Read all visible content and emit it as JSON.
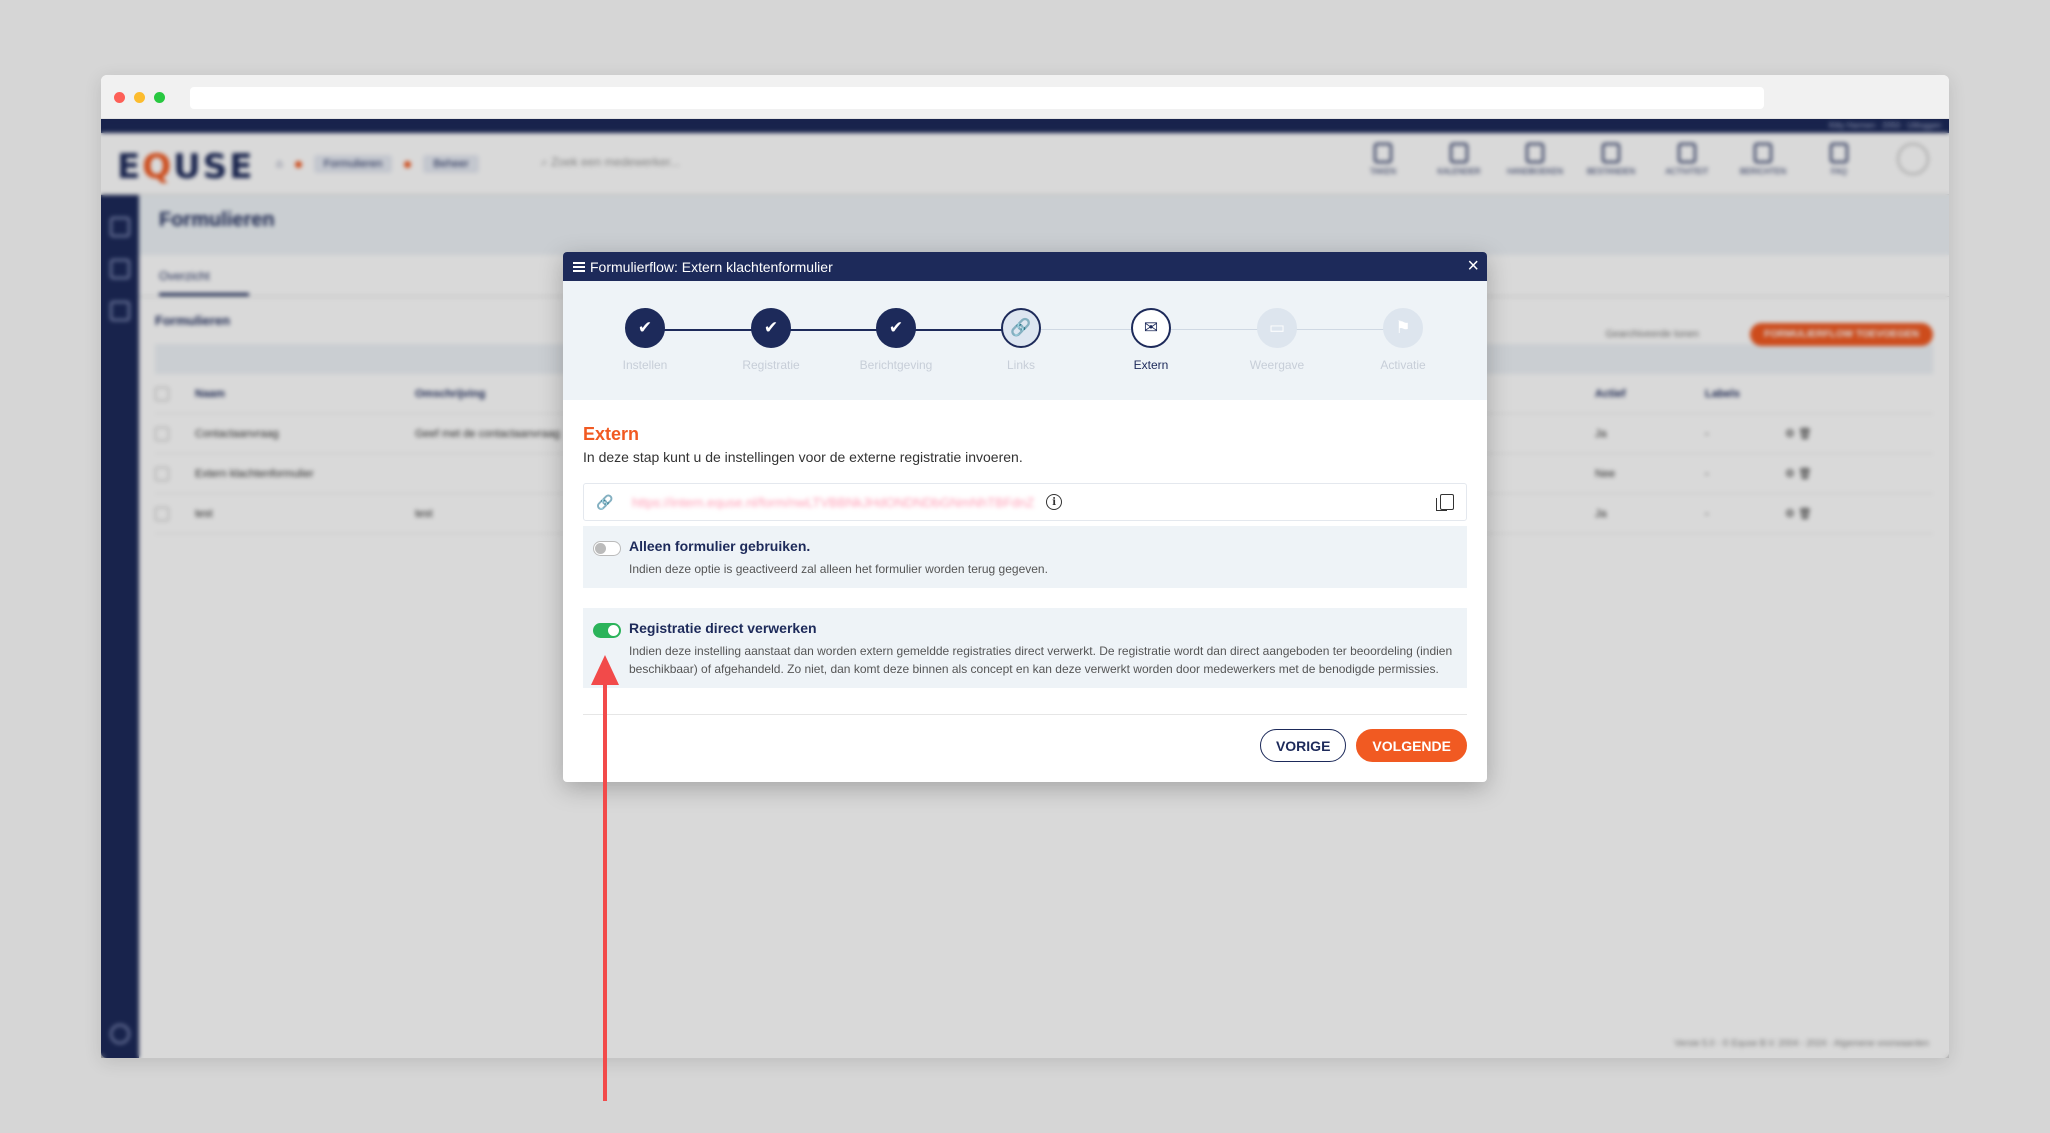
{
  "app": {
    "logo_prefix": "E",
    "logo_q": "Q",
    "logo_suffix": "USE",
    "user_info": "Kitty Harmen · 2050 · Uitloggen",
    "crumbs": [
      "Formulieren",
      "Beheer"
    ],
    "search_placeholder": "Zoek een medewerker...",
    "nav_items": [
      "TAKEN",
      "KALENDER",
      "HANDBOEKEN",
      "BESTANDEN",
      "ACTIVITEIT",
      "BERICHTEN",
      "FAQ"
    ],
    "page_title": "Formulieren",
    "tab_overview": "Overzicht",
    "list_title": "Formulieren",
    "add_button": "FORMULIERFLOW TOEVOEGEN",
    "toggle_note": "Gearchiveerde tonen",
    "table": {
      "headers": [
        "Naam",
        "Omschrijving",
        "Actief",
        "Labels"
      ],
      "rows": [
        {
          "name": "Contactaanvraag",
          "desc": "Geef met de contactaanvraag",
          "active": "Ja",
          "labels": "-"
        },
        {
          "name": "Extern klachtenformulier",
          "desc": "",
          "active": "Nee",
          "labels": "-"
        },
        {
          "name": "test",
          "desc": "test",
          "active": "Ja",
          "labels": "-"
        }
      ]
    },
    "footer": "Versie 5.0 · © Equse B.V. 2004 - 2024 · Algemene voorwaarden"
  },
  "modal": {
    "title": "Formulierflow: Extern klachtenformulier",
    "close": "×",
    "steps": [
      {
        "label": "Instellen",
        "state": "done",
        "icon": "check-icon"
      },
      {
        "label": "Registratie",
        "state": "done",
        "icon": "check-icon"
      },
      {
        "label": "Berichtgeving",
        "state": "done",
        "icon": "check-icon"
      },
      {
        "label": "Links",
        "state": "visited",
        "icon": "link-icon"
      },
      {
        "label": "Extern",
        "state": "current",
        "icon": "envelope-icon"
      },
      {
        "label": "Weergave",
        "state": "future",
        "icon": "monitor-icon"
      },
      {
        "label": "Activatie",
        "state": "future",
        "icon": "flag-icon"
      }
    ],
    "section_title": "Extern",
    "section_desc": "In deze stap kunt u de instellingen voor de externe registratie invoeren.",
    "link_url": "https://intern.equse.nl/form/nwLTVBBNkJHdONDNDbGNmNhTBFdnZ",
    "option1": {
      "title": "Alleen formulier gebruiken.",
      "desc": "Indien deze optie is geactiveerd zal alleen het formulier worden terug gegeven.",
      "enabled": false
    },
    "option2": {
      "title": "Registratie direct verwerken",
      "desc": "Indien deze instelling aanstaat dan worden extern gemeldde registraties direct verwerkt. De registratie wordt dan direct aangeboden ter beoordeling (indien beschikbaar) of afgehandeld. Zo niet, dan komt deze binnen als concept en kan deze verwerkt worden door medewerkers met de benodigde permissies.",
      "enabled": true
    },
    "btn_prev": "VORIGE",
    "btn_next": "VOLGENDE"
  },
  "colors": {
    "navy": "#1d2a5a",
    "accent": "#f15a22",
    "toggle_on": "#2bb35a",
    "annotation_arrow": "#f24a4a"
  }
}
